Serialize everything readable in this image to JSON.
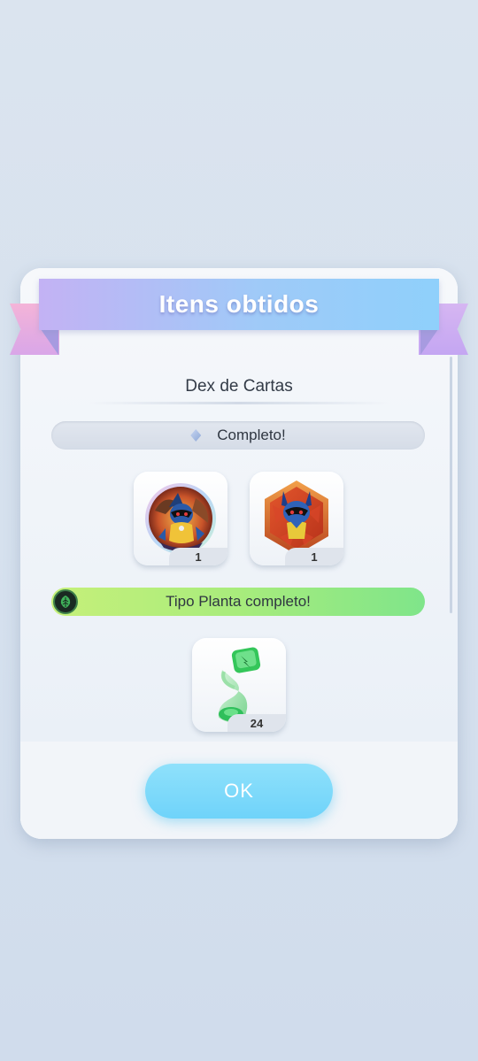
{
  "dialog": {
    "title": "Itens obtidos",
    "section_title": "Dex de Cartas",
    "completion_status": "Completo!",
    "type_status": "Tipo Planta completo!",
    "ok_label": "OK"
  },
  "rewards": [
    {
      "icon": "lucario-avatar-icon",
      "count": "1"
    },
    {
      "icon": "lucario-hexagon-badge-icon",
      "count": "1"
    }
  ],
  "type_rewards": [
    {
      "icon": "green-hourglass-item-icon",
      "count": "24"
    }
  ],
  "colors": {
    "ribbon_start": "#c3b2f4",
    "ribbon_end": "#8fd0fb",
    "ok_button": "#6fd3fa",
    "type_bar_start": "#c6f07a",
    "type_bar_end": "#7fe58a"
  }
}
